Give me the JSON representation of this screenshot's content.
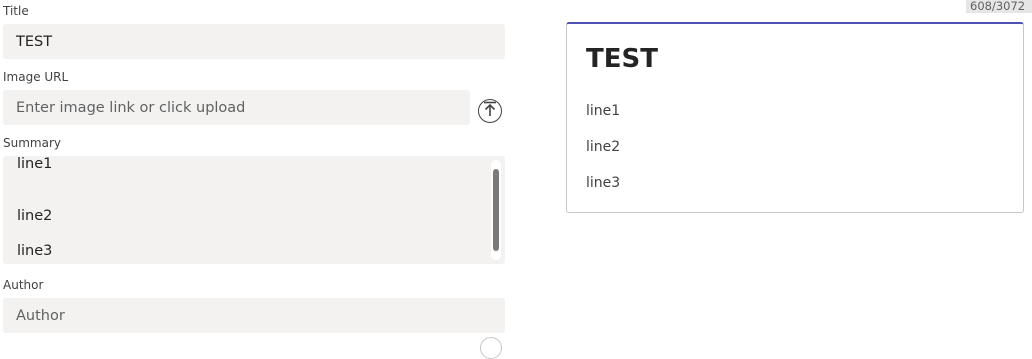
{
  "form": {
    "title_label": "Title",
    "title_value": "TEST",
    "image_label": "Image URL",
    "image_placeholder": "Enter image link or click upload",
    "summary_label": "Summary",
    "summary_lines": [
      "line1",
      "line2",
      "line3"
    ],
    "author_label": "Author",
    "author_placeholder": "Author"
  },
  "counter": "608/3072",
  "preview": {
    "title": "TEST",
    "lines": [
      "line1",
      "line2",
      "line3"
    ]
  },
  "icons": {
    "upload": "upload-icon"
  },
  "colors": {
    "field_bg": "#f3f2f1",
    "card_accent": "#4f52b2",
    "scroll_thumb": "#7a7a7a"
  }
}
